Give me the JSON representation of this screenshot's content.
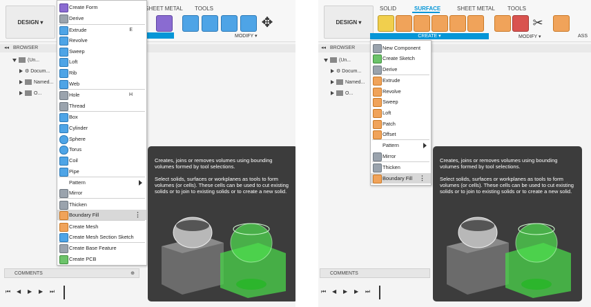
{
  "left": {
    "design_label": "DESIGN ▾",
    "tabs": [
      "SHEET METAL",
      "TOOLS"
    ],
    "modify_label": "MODIFY ▾",
    "browser_label": "BROWSER",
    "tree": [
      {
        "label": "(Un..."
      },
      {
        "label": "Docum..."
      },
      {
        "label": "Named..."
      },
      {
        "label": "O..."
      }
    ],
    "comments_label": "COMMENTS",
    "menu": [
      {
        "label": "Create Form",
        "shortcut": ""
      },
      {
        "label": "Derive",
        "shortcut": ""
      },
      {
        "label": "Extrude",
        "shortcut": "E"
      },
      {
        "label": "Revolve",
        "shortcut": ""
      },
      {
        "label": "Sweep",
        "shortcut": ""
      },
      {
        "label": "Loft",
        "shortcut": ""
      },
      {
        "label": "Rib",
        "shortcut": ""
      },
      {
        "label": "Web",
        "shortcut": ""
      },
      {
        "label": "Hole",
        "shortcut": "H"
      },
      {
        "label": "Thread",
        "shortcut": ""
      },
      {
        "label": "Box",
        "shortcut": ""
      },
      {
        "label": "Cylinder",
        "shortcut": ""
      },
      {
        "label": "Sphere",
        "shortcut": ""
      },
      {
        "label": "Torus",
        "shortcut": ""
      },
      {
        "label": "Coil",
        "shortcut": ""
      },
      {
        "label": "Pipe",
        "shortcut": ""
      },
      {
        "label": "Pattern",
        "shortcut": ""
      },
      {
        "label": "Mirror",
        "shortcut": ""
      },
      {
        "label": "Thicken",
        "shortcut": ""
      },
      {
        "label": "Boundary Fill",
        "shortcut": ""
      },
      {
        "label": "Create Mesh",
        "shortcut": ""
      },
      {
        "label": "Create Mesh Section Sketch",
        "shortcut": ""
      },
      {
        "label": "Create Base Feature",
        "shortcut": ""
      },
      {
        "label": "Create PCB",
        "shortcut": ""
      }
    ],
    "tooltip_p1": "Creates, joins or removes volumes using bounding volumes formed by tool selections.",
    "tooltip_p2": "Select solids, surfaces or workplanes as tools to form volumes (or cells). These cells can be used to cut existing solids or to join to existing solids or to create a new solid."
  },
  "right": {
    "design_label": "DESIGN ▾",
    "tabs": [
      "SOLID",
      "SURFACE",
      "SHEET METAL",
      "TOOLS"
    ],
    "create_label": "CREATE ▾",
    "modify_label": "MODIFY ▾",
    "ass_label": "ASS",
    "browser_label": "BROWSER",
    "tree": [
      {
        "label": "(Un..."
      },
      {
        "label": "Docum..."
      },
      {
        "label": "Named..."
      },
      {
        "label": "O..."
      }
    ],
    "comments_label": "COMMENTS",
    "menu": [
      {
        "label": "New Component"
      },
      {
        "label": "Create Sketch"
      },
      {
        "label": "Derive"
      },
      {
        "label": "Extrude"
      },
      {
        "label": "Revolve"
      },
      {
        "label": "Sweep"
      },
      {
        "label": "Loft"
      },
      {
        "label": "Patch"
      },
      {
        "label": "Offset"
      },
      {
        "label": "Pattern"
      },
      {
        "label": "Mirror"
      },
      {
        "label": "Thicken"
      },
      {
        "label": "Boundary Fill"
      }
    ],
    "tooltip_p1": "Creates, joins or removes volumes using bounding volumes formed by tool selections.",
    "tooltip_p2": "Select solids, surfaces or workplanes as tools to form volumes (or cells). These cells can be used to cut existing solids or to join to existing solids or to create a new solid."
  }
}
